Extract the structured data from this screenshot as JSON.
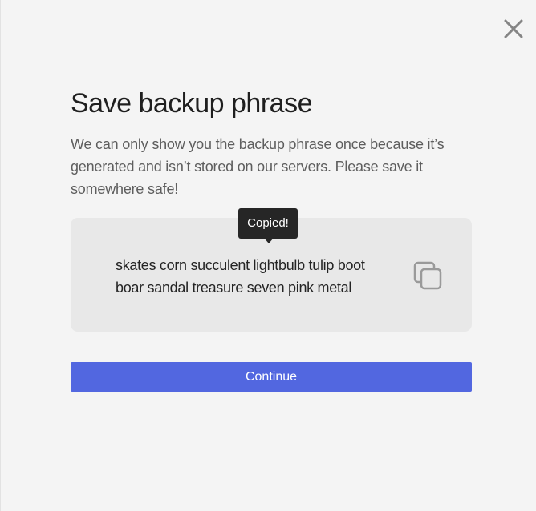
{
  "dialog": {
    "title": "Save backup phrase",
    "description": "We can only show you the backup phrase once because it’s generated and isn’t stored on our servers. Please save it somewhere safe!",
    "close_icon": "close-icon"
  },
  "phrase": {
    "words": "skates corn succulent lightbulb tulip boot boar sandal treasure seven pink metal",
    "copy_icon": "copy-icon",
    "tooltip": "Copied!"
  },
  "actions": {
    "continue_label": "Continue",
    "accent_color": "#5267e0"
  }
}
